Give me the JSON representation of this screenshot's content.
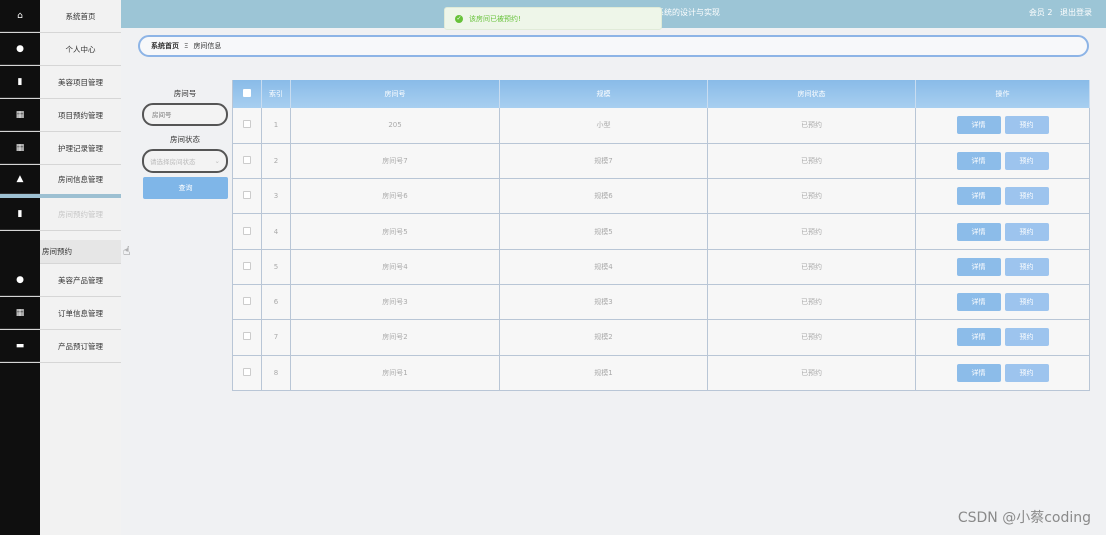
{
  "header": {
    "title": "系统的设计与实现",
    "user_label": "会员 2",
    "logout_label": "退出登录",
    "color": "#9cc5d6"
  },
  "toast": {
    "message": "该房间已被预约!"
  },
  "sidebar": {
    "items": [
      {
        "label": "系统首页",
        "icon": "home-icon"
      },
      {
        "label": "个人中心",
        "icon": "user-icon"
      },
      {
        "label": "美容项目管理",
        "icon": "clipboard-icon"
      },
      {
        "label": "项目预约管理",
        "icon": "grid-icon"
      },
      {
        "label": "护理记录管理",
        "icon": "grid-icon"
      },
      {
        "label": "房间信息管理",
        "icon": "thumb-icon"
      },
      {
        "label": "房间预约管理",
        "icon": "clipboard-icon"
      },
      {
        "label": "美容产品管理",
        "icon": "user-icon"
      },
      {
        "label": "订单信息管理",
        "icon": "table-icon"
      },
      {
        "label": "产品预订管理",
        "icon": "monitor-icon"
      }
    ],
    "submenu_label": "房间预约"
  },
  "breadcrumb": {
    "home": "系统首页",
    "separator": "Ξ",
    "current": "房间信息"
  },
  "search": {
    "room_label": "房间号",
    "room_placeholder": "房间号",
    "status_label": "房间状态",
    "status_placeholder": "请选择房间状态",
    "query_button": "查询"
  },
  "table": {
    "columns": [
      "索引",
      "房间号",
      "规模",
      "房间状态",
      "操作"
    ],
    "detail_label": "详情",
    "book_label": "预约",
    "rows": [
      {
        "index": "1",
        "room": "205",
        "scale": "小型",
        "status": "已预约"
      },
      {
        "index": "2",
        "room": "房间号7",
        "scale": "规模7",
        "status": "已预约"
      },
      {
        "index": "3",
        "room": "房间号6",
        "scale": "规模6",
        "status": "已预约"
      },
      {
        "index": "4",
        "room": "房间号5",
        "scale": "规模5",
        "status": "已预约"
      },
      {
        "index": "5",
        "room": "房间号4",
        "scale": "规模4",
        "status": "已预约"
      },
      {
        "index": "6",
        "room": "房间号3",
        "scale": "规模3",
        "status": "已预约"
      },
      {
        "index": "7",
        "room": "房间号2",
        "scale": "规模2",
        "status": "已预约"
      },
      {
        "index": "8",
        "room": "房间号1",
        "scale": "规模1",
        "status": "已预约"
      }
    ]
  },
  "watermark": "CSDN @小蔡coding"
}
